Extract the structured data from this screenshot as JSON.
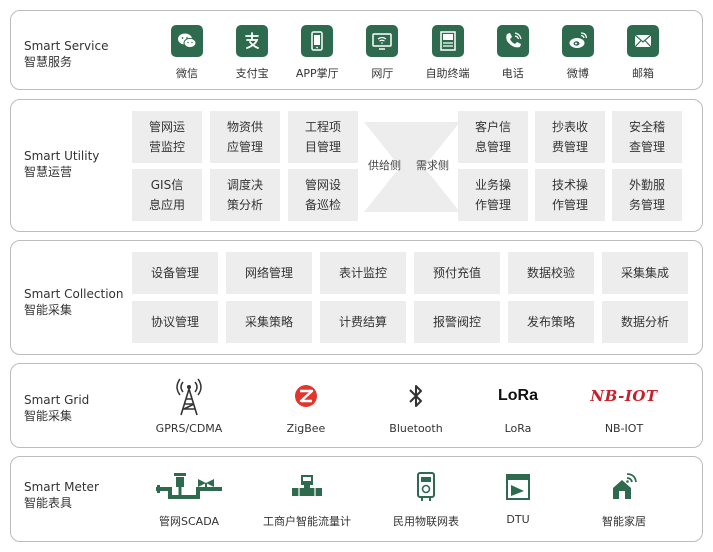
{
  "colors": {
    "icon_green": "#2e6b4e",
    "cell_bg": "#ededed",
    "border": "#bcbcbc",
    "zigbee_red": "#e2352d",
    "nbiot_red": "#c8202a"
  },
  "service": {
    "label_en": "Smart Service",
    "label_cn": "智慧服务",
    "items": [
      {
        "icon": "wechat-icon",
        "label": "微信"
      },
      {
        "icon": "alipay-icon",
        "label": "支付宝"
      },
      {
        "icon": "mobile-app-icon",
        "label": "APP掌厅"
      },
      {
        "icon": "web-hall-icon",
        "label": "网厅"
      },
      {
        "icon": "kiosk-icon",
        "label": "自助终端"
      },
      {
        "icon": "phone-icon",
        "label": "电话"
      },
      {
        "icon": "weibo-icon",
        "label": "微博"
      },
      {
        "icon": "mail-icon",
        "label": "邮箱"
      }
    ]
  },
  "utility": {
    "label_en": "Smart Utility",
    "label_cn": "智慧运营",
    "supply_label": "供给侧",
    "demand_label": "需求侧",
    "supply_cells": [
      [
        "管网运",
        "营监控"
      ],
      [
        "物资供",
        "应管理"
      ],
      [
        "工程项",
        "目管理"
      ],
      [
        "GIS信",
        "息应用"
      ],
      [
        "调度决",
        "策分析"
      ],
      [
        "管网设",
        "备巡检"
      ]
    ],
    "demand_cells": [
      [
        "客户信",
        "息管理"
      ],
      [
        "抄表收",
        "费管理"
      ],
      [
        "安全稽",
        "查管理"
      ],
      [
        "业务操",
        "作管理"
      ],
      [
        "技术操",
        "作管理"
      ],
      [
        "外勤服",
        "务管理"
      ]
    ]
  },
  "collection": {
    "label_en": "Smart Collection",
    "label_cn": "智能采集",
    "cells": [
      "设备管理",
      "网络管理",
      "表计监控",
      "预付充值",
      "数据校验",
      "采集集成",
      "协议管理",
      "采集策略",
      "计费结算",
      "报警阀控",
      "发布策略",
      "数据分析"
    ]
  },
  "grid": {
    "label_en": "Smart Grid",
    "label_cn": "智能采集",
    "items": [
      {
        "icon": "cell-tower-icon",
        "label": "GPRS/CDMA"
      },
      {
        "icon": "zigbee-icon",
        "label": "ZigBee"
      },
      {
        "icon": "bluetooth-icon",
        "label": "Bluetooth"
      },
      {
        "icon": "lora-logo",
        "label": "LoRa",
        "logo_text": "LoRa"
      },
      {
        "icon": "nbiot-logo",
        "label": "NB-IOT",
        "logo_text": "NB-IOT"
      }
    ]
  },
  "meter": {
    "label_en": "Smart Meter",
    "label_cn": "智能表具",
    "items": [
      {
        "icon": "pipeline-scada-icon",
        "label": "管网SCADA"
      },
      {
        "icon": "flow-meter-icon",
        "label": "工商户智能流量计"
      },
      {
        "icon": "iot-meter-icon",
        "label": "民用物联网表"
      },
      {
        "icon": "dtu-icon",
        "label": "DTU"
      },
      {
        "icon": "smart-home-icon",
        "label": "智能家居"
      }
    ]
  }
}
